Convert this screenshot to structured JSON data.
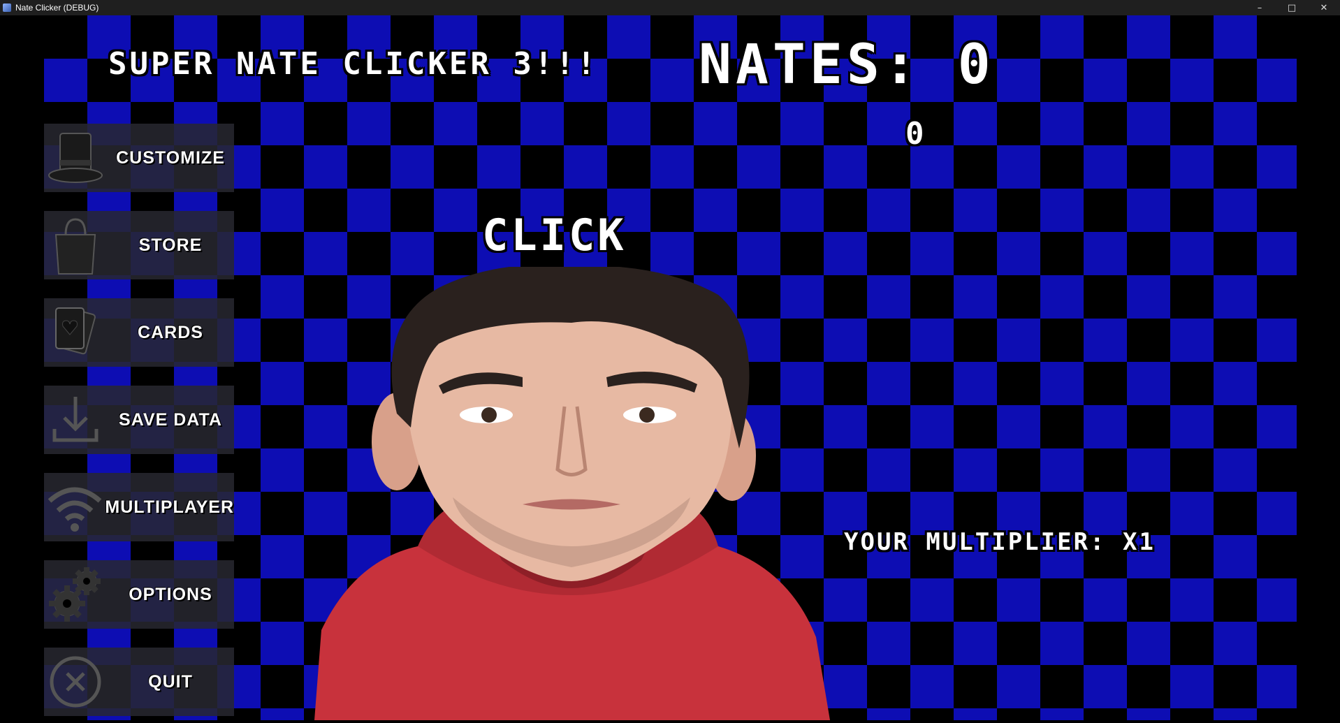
{
  "window": {
    "title": "Nate Clicker (DEBUG)"
  },
  "window_controls": [
    "–",
    "□",
    "✕"
  ],
  "game": {
    "title": "SUPER NATE CLICKER 3!!!",
    "nates_label": "NATES:",
    "nates_count": "0",
    "nates_per_second": "0",
    "click_label": "CLICK",
    "multiplier_label": "YOUR MULTIPLIER: X1"
  },
  "menu": [
    {
      "label": "CUSTOMIZE",
      "icon": "top-hat-icon"
    },
    {
      "label": "STORE",
      "icon": "shopping-bag-icon"
    },
    {
      "label": "CARDS",
      "icon": "cards-icon"
    },
    {
      "label": "SAVE DATA",
      "icon": "download-icon"
    },
    {
      "label": "MULTIPLAYER",
      "icon": "wifi-icon"
    },
    {
      "label": "OPTIONS",
      "icon": "gear-icon"
    },
    {
      "label": "QUIT",
      "icon": "close-circle-icon"
    }
  ],
  "colors": {
    "checker_blue": "#0d0db3",
    "checker_black": "#000000",
    "hoodie_red": "#c8323c"
  }
}
